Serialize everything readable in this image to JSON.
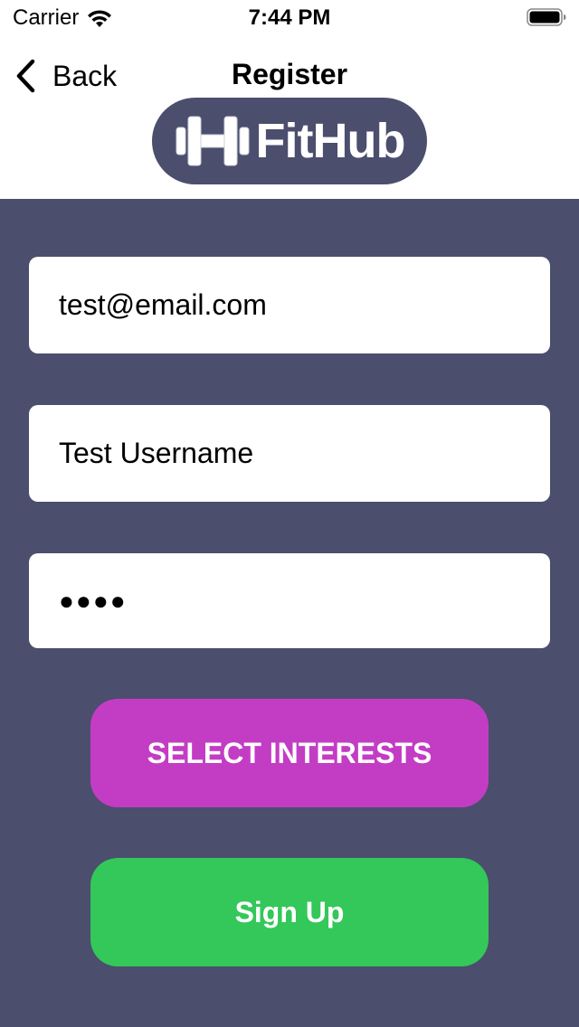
{
  "status_bar": {
    "carrier": "Carrier",
    "time": "7:44 PM",
    "wifi_icon": "wifi-icon",
    "battery_icon": "battery-icon"
  },
  "nav": {
    "back_label": "Back",
    "back_icon": "chevron-left-icon",
    "title": "Register"
  },
  "logo": {
    "text": "FitHub",
    "icon": "dumbbell-icon",
    "background": "#4b4e6d"
  },
  "form": {
    "email_value": "test@email.com",
    "username_value": "Test Username",
    "password_mask": "●●●●",
    "select_interests_label": "SELECT INTERESTS",
    "sign_up_label": "Sign Up"
  },
  "colors": {
    "background": "#4b4e6d",
    "interests_button": "#c33dc4",
    "sign_up_button": "#34c759"
  }
}
